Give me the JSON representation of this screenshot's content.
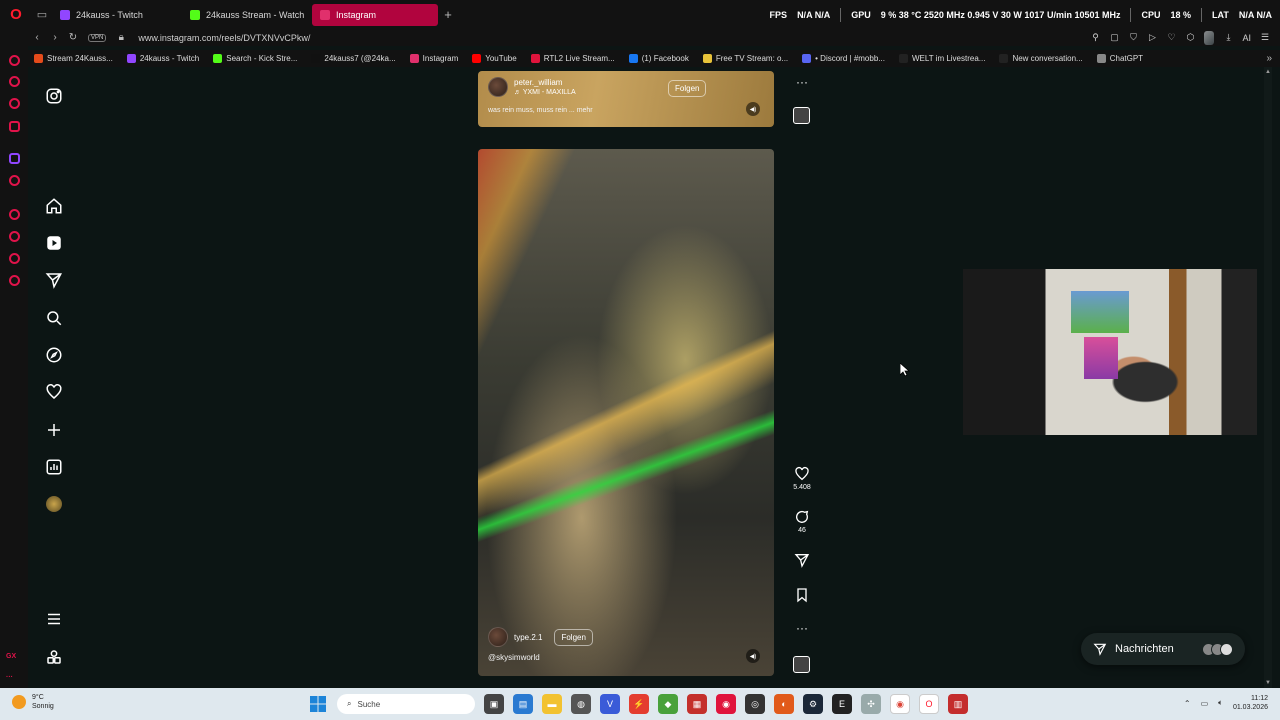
{
  "tabs": [
    {
      "label": "24kauss - Twitch",
      "color": "#9146ff",
      "active": false
    },
    {
      "label": "24kauss Stream - Watch",
      "color": "#53fc18",
      "active": false
    },
    {
      "label": "Instagram",
      "color": "#e1306c",
      "active": true
    }
  ],
  "hud": {
    "fps_label": "FPS",
    "fps_value": "N/A N/A",
    "gpu_label": "GPU",
    "gpu_value": "9 %  38 °C  2520 MHz  0.945 V  30 W  1017 U/min  10501 MHz",
    "cpu_label": "CPU",
    "cpu_value": "18 %",
    "lat_label": "LAT",
    "lat_value": "N/A N/A"
  },
  "address": {
    "vpn_label": "VPN",
    "url": "www.instagram.com/reels/DVTXNVvCPkw/",
    "ai_label": "AI"
  },
  "bookmarks": [
    {
      "label": "Stream 24Kauss...",
      "color": "#e54b1b"
    },
    {
      "label": "24kauss - Twitch",
      "color": "#9146ff"
    },
    {
      "label": "Search - Kick Stre...",
      "color": "#53fc18"
    },
    {
      "label": "24kauss7 (@24ka...",
      "color": "#111111"
    },
    {
      "label": "Instagram",
      "color": "#e1306c"
    },
    {
      "label": "YouTube",
      "color": "#ff0000"
    },
    {
      "label": "RTL2 Live Stream...",
      "color": "#e0143c"
    },
    {
      "label": "(1) Facebook",
      "color": "#1877f2"
    },
    {
      "label": "Free TV Stream: o...",
      "color": "#e8c33a"
    },
    {
      "label": "• Discord | #mobb...",
      "color": "#5865f2"
    },
    {
      "label": "WELT im Livestrea...",
      "color": "#222222"
    },
    {
      "label": "New conversation...",
      "color": "#222222"
    },
    {
      "label": "ChatGPT",
      "color": "#888888"
    }
  ],
  "reel_top": {
    "username": "peter._william",
    "audio": "♬  YXMI - MAXILLA",
    "follow": "Folgen",
    "caption": "was rein muss, muss rein ... mehr"
  },
  "reel_main": {
    "username": "type.2.1",
    "follow": "Folgen",
    "tagged": "@skysimworld",
    "likes": "5.408",
    "comments": "46"
  },
  "messages": {
    "label": "Nachrichten"
  },
  "taskbar": {
    "weather_temp": "9°C",
    "weather_text": "Sonnig",
    "search_placeholder": "Suche",
    "time": "11:12",
    "date": "01.03.2026"
  },
  "colors": {
    "accent": "#b1043e",
    "background": "#0c1514",
    "opera_red": "#ff1b2d"
  }
}
